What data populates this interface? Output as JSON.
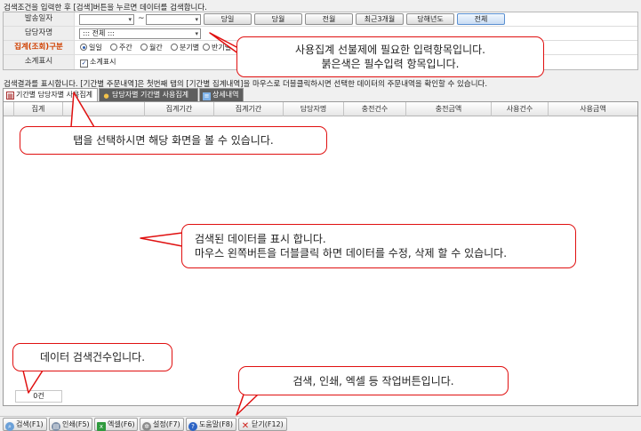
{
  "search_caption": "검색조건을 입력한 후 [검색]버튼을 누르면 데이터를 검색합니다.",
  "conditions": {
    "date_label": "발송일자",
    "date_tilde": "~",
    "period_buttons": [
      "당일",
      "당월",
      "전월",
      "최근3개월",
      "당해년도",
      "전체"
    ],
    "manager_label": "담당자명",
    "manager_value": "::: 전체 :::",
    "group_label": "집계(조회)구분",
    "group_options": [
      "일일",
      "주간",
      "월간",
      "분기별",
      "반기별"
    ],
    "subtotal_label": "소계표시",
    "subtotal_check": "소계표시",
    "arrow_glyph": "▾",
    "check_glyph": "✓"
  },
  "result_caption": "검색결과를 표시합니다. [기간별 주문내역]은 첫번째 탭의 [기간별 집계내역]을 마우스로 더블클릭하시면 선택한 데이터의 주문내역을 확인할 수 있습니다.",
  "tabs": [
    "기간별 담당자별 사용집계",
    "담당자별 기간별 사용집계",
    "상세내역"
  ],
  "grid": {
    "columns": [
      "집계",
      "",
      "집계기간",
      "집계기간",
      "담당자명",
      "충전건수",
      "충전금액",
      "사용건수",
      "사용금액"
    ],
    "count_text": "0건"
  },
  "toolbar": {
    "buttons": [
      {
        "label": "검색(F1)",
        "icon": "search-icon"
      },
      {
        "label": "인쇄(F5)",
        "icon": "printer-icon"
      },
      {
        "label": "엑셀(F6)",
        "icon": "excel-icon"
      },
      {
        "label": "설정(F7)",
        "icon": "gear-icon"
      },
      {
        "label": "도움말(F8)",
        "icon": "help-icon"
      },
      {
        "label": "닫기(F12)",
        "icon": "close-icon"
      }
    ]
  },
  "callouts": {
    "required_fields": [
      "사용집계 선불제에  필요한 입력항목입니다.",
      "붉은색은 필수입력 항목입니다."
    ],
    "tabs_hint": "탭을 선택하시면 해당 화면을 볼 수 있습니다.",
    "data_hint": [
      "검색된 데이터를 표시 합니다.",
      "마우스 왼쪽버튼을 더블클릭 하면 데이터를 수정, 삭제 할 수 있습니다."
    ],
    "count_hint": "데이터 검색건수입니다.",
    "toolbar_hint": "검색, 인쇄, 엑셀  등 작업버튼입니다."
  },
  "colors": {
    "required_label": "#d04000",
    "callout_border": "#e01010",
    "tab_inactive": "#5e5e5e"
  }
}
